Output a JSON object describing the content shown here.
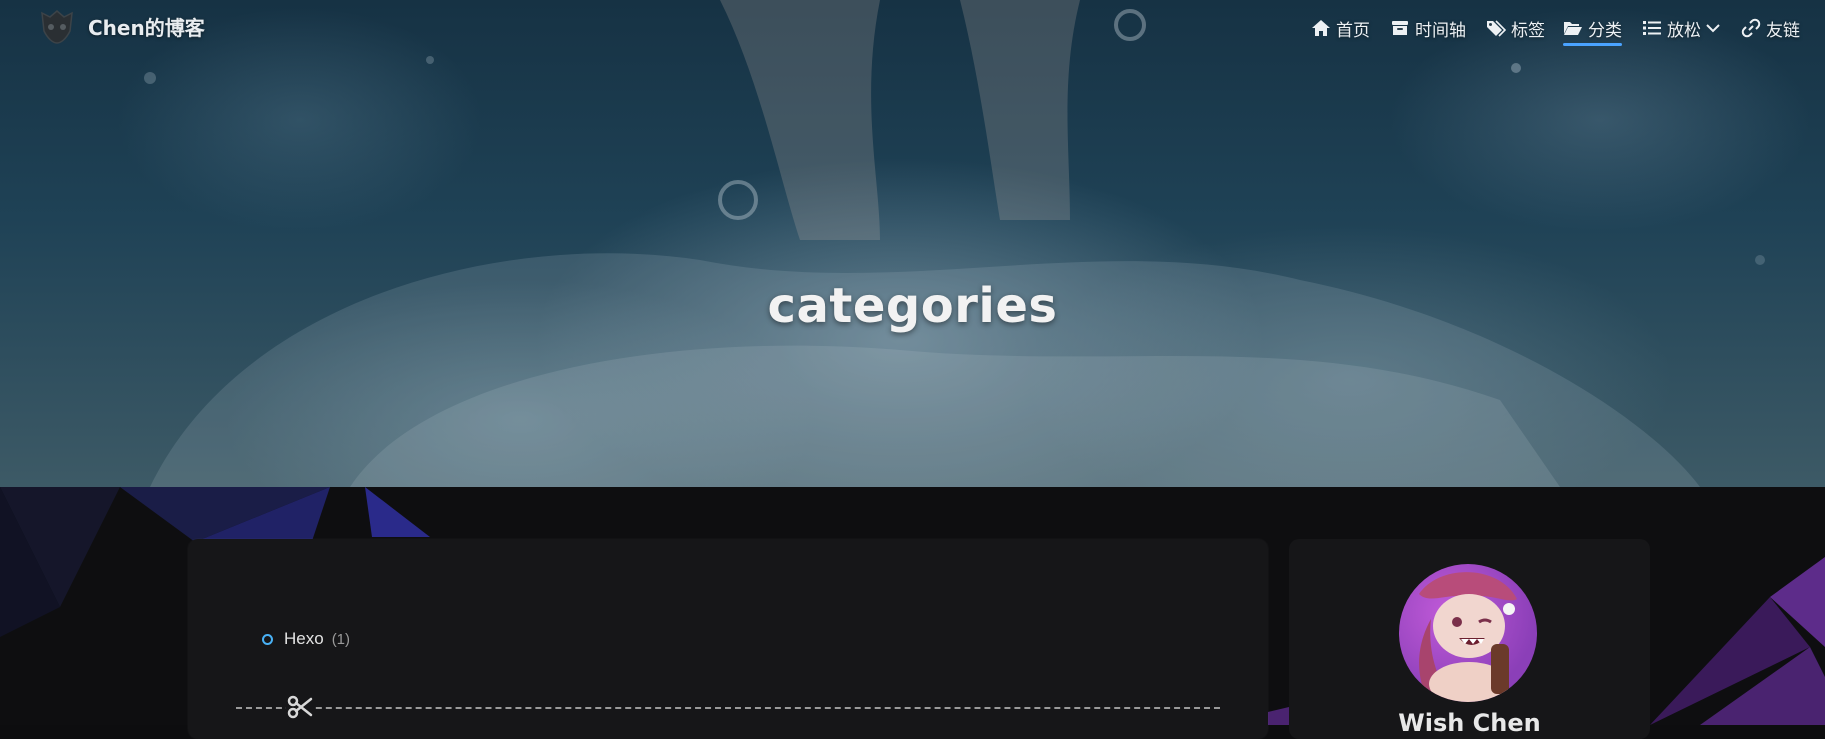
{
  "site": {
    "brand_name": "Chen的博客"
  },
  "nav": {
    "items": [
      {
        "label": "首页",
        "icon": "home-icon"
      },
      {
        "label": "时间轴",
        "icon": "archive-icon"
      },
      {
        "label": "标签",
        "icon": "tags-icon"
      },
      {
        "label": "分类",
        "icon": "folder-open-icon",
        "active": true
      },
      {
        "label": "放松",
        "icon": "list-icon",
        "has_dropdown": true
      },
      {
        "label": "友链",
        "icon": "link-icon"
      }
    ]
  },
  "hero": {
    "title": "categories"
  },
  "categories": [
    {
      "name": "Hexo",
      "count": "(1)"
    }
  ],
  "author": {
    "name": "Wish Chen"
  },
  "colors": {
    "accent": "#49b1f5",
    "card_bg": "#161618",
    "page_bg": "#0e0e10"
  }
}
